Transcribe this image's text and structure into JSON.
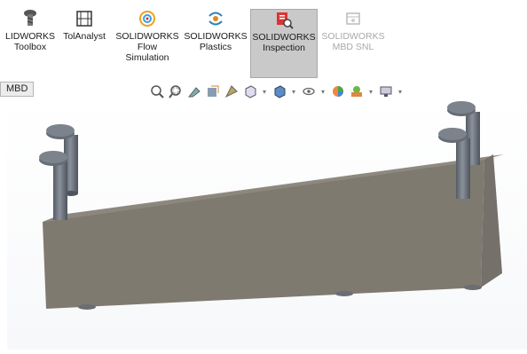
{
  "ribbon": {
    "buttons": [
      {
        "id": "toolbox",
        "lines": [
          "LIDWORKS",
          "Toolbox"
        ],
        "icon": "screw-icon"
      },
      {
        "id": "tolanalyst",
        "lines": [
          "TolAnalyst"
        ],
        "icon": "tolerance-icon"
      },
      {
        "id": "flow",
        "lines": [
          "SOLIDWORKS",
          "Flow",
          "Simulation"
        ],
        "icon": "flow-icon"
      },
      {
        "id": "plastics",
        "lines": [
          "SOLIDWORKS",
          "Plastics"
        ],
        "icon": "plastics-icon"
      },
      {
        "id": "inspection",
        "lines": [
          "SOLIDWORKS",
          "Inspection"
        ],
        "icon": "inspection-icon",
        "state": "active"
      },
      {
        "id": "mbdsnl",
        "lines": [
          "SOLIDWORKS",
          "MBD SNL"
        ],
        "icon": "mbd-snl-icon",
        "state": "disabled"
      }
    ]
  },
  "tabs": {
    "mbd": "MBD"
  },
  "view_toolbar": {
    "icons": [
      "zoom-to-fit-icon",
      "zoom-to-area-icon",
      "previous-view-icon",
      "section-view-icon",
      "dynamic-annotation-icon",
      "view-orientation-icon",
      "display-style-icon",
      "hide-show-icon",
      "edit-appearance-icon",
      "apply-scene-icon",
      "view-settings-icon"
    ]
  },
  "colors": {
    "part_top": "#8f8a80",
    "part_front": "#7f7a70",
    "part_side": "#77726a",
    "pin": "#6d747d",
    "active_bg": "#c9c9c9"
  }
}
